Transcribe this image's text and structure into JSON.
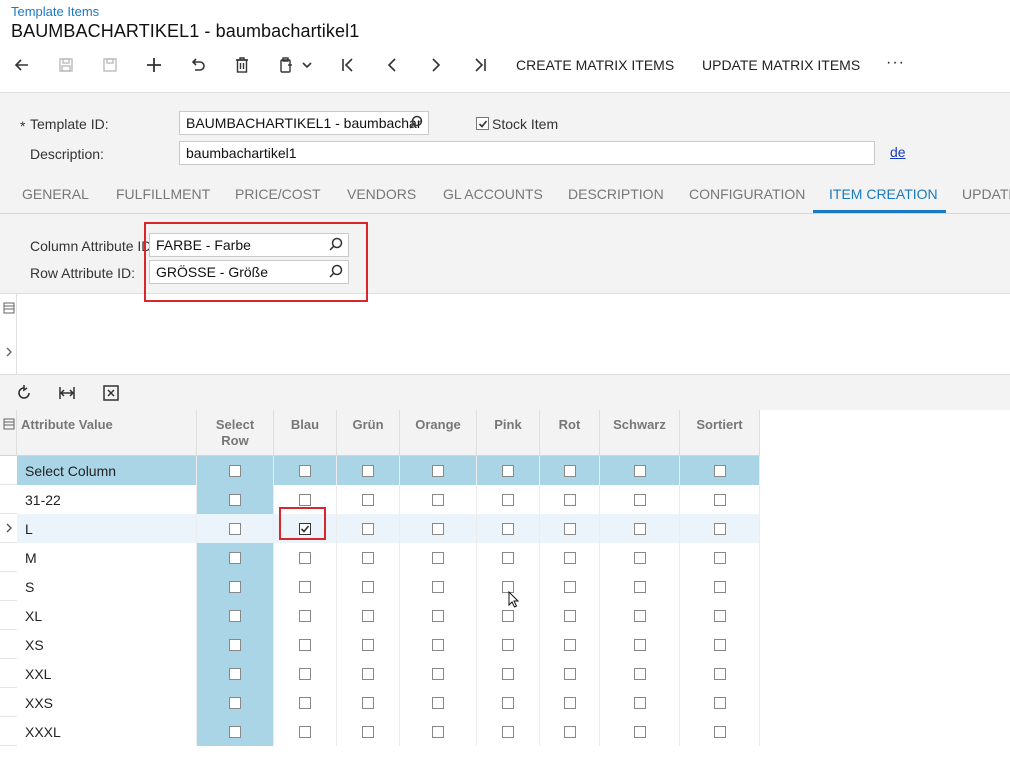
{
  "header": {
    "breadcrumb": "Template Items",
    "title": "BAUMBACHARTIKEL1 - baumbachartikel1"
  },
  "toolbar": {
    "create_matrix": "CREATE MATRIX ITEMS",
    "update_matrix": "UPDATE MATRIX ITEMS",
    "more": "···"
  },
  "summary": {
    "template_id_label": "Template ID:",
    "template_id_value": "BAUMBACHARTIKEL1 - baumbachar",
    "stock_item_label": "Stock Item",
    "stock_item_checked": true,
    "description_label": "Description:",
    "description_value": "baumbachartikel1",
    "lang_link": "de"
  },
  "tabs": [
    "GENERAL",
    "FULFILLMENT",
    "PRICE/COST",
    "VENDORS",
    "GL ACCOUNTS",
    "DESCRIPTION",
    "CONFIGURATION",
    "ITEM CREATION",
    "UPDATE"
  ],
  "active_tab": "ITEM CREATION",
  "attributes": {
    "column_label": "Column Attribute ID:",
    "column_value": "FARBE - Farbe",
    "row_label": "Row Attribute ID:",
    "row_value": "GRÖSSE - Größe"
  },
  "grid": {
    "headers": [
      "Attribute Value",
      "Select Row",
      "Blau",
      "Grün",
      "Orange",
      "Pink",
      "Rot",
      "Schwarz",
      "Sortiert"
    ],
    "rows": [
      {
        "name": "Select Column",
        "checked": []
      },
      {
        "name": "31-22",
        "checked": []
      },
      {
        "name": "L",
        "checked": [
          "Blau"
        ]
      },
      {
        "name": "M",
        "checked": []
      },
      {
        "name": "S",
        "checked": []
      },
      {
        "name": "XL",
        "checked": []
      },
      {
        "name": "XS",
        "checked": []
      },
      {
        "name": "XXL",
        "checked": []
      },
      {
        "name": "XXS",
        "checked": []
      },
      {
        "name": "XXXL",
        "checked": []
      }
    ]
  },
  "colors": {
    "accent": "#1a7ac1",
    "highlight_red": "#d9262c",
    "select_row_bg": "#a9d5e6",
    "selected_cell": "#0000ee"
  }
}
